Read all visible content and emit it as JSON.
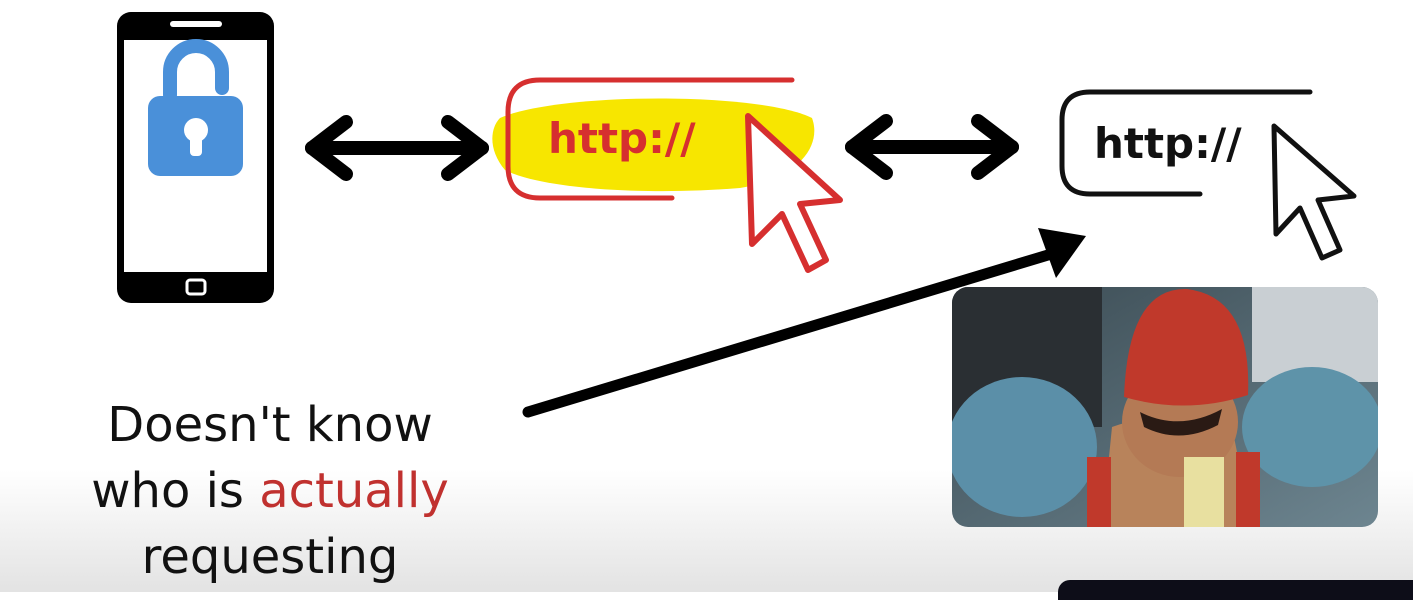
{
  "left_url": {
    "text": "http://",
    "color": "#d62f2f",
    "highlight": "#f7e600"
  },
  "right_url": {
    "text": "http://",
    "color": "#111111"
  },
  "caption": {
    "line1": "Doesn't know",
    "line2_prefix": "who is",
    "line2_accent": "actually",
    "line3": "requesting"
  },
  "colors": {
    "lock": "#4a90d9",
    "phone": "#000000",
    "accent": "#c0312f",
    "arrow": "#000000"
  },
  "icons": [
    "phone-icon",
    "unlocked-padlock-icon",
    "double-arrow-icon",
    "cursor-icon"
  ]
}
